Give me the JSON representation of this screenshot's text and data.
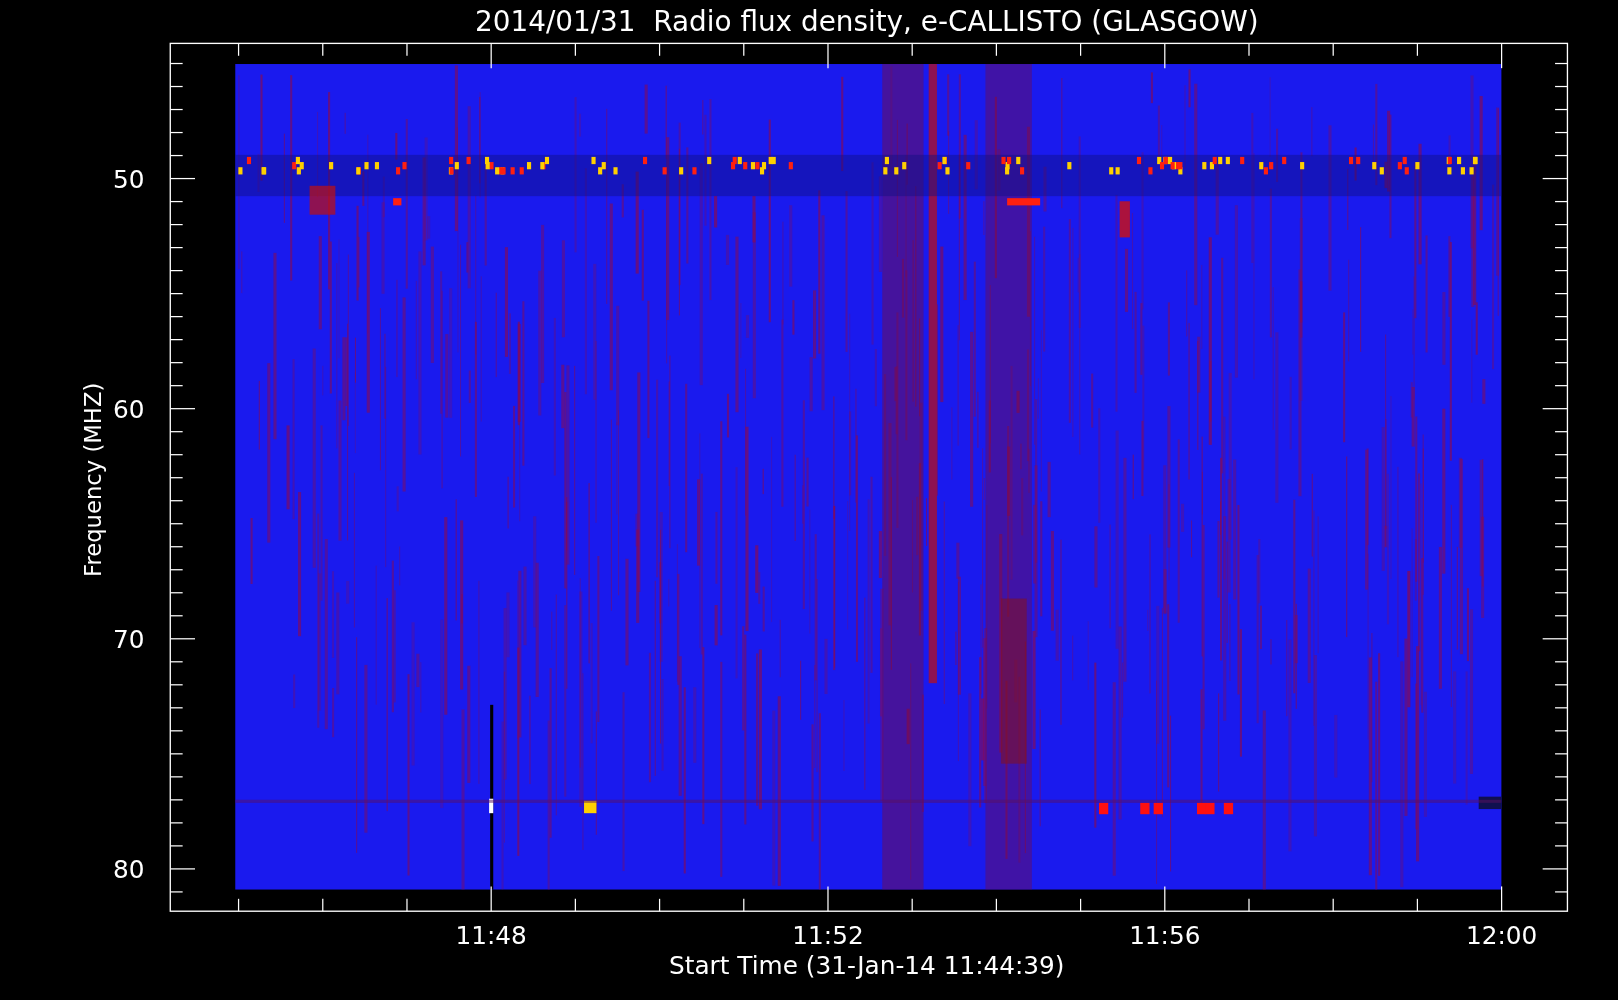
{
  "chart": {
    "title": "2014/01/31  Radio flux density, e-CALLISTO (GLASGOW)",
    "xlabel": "Start Time (31-Jan-14 11:44:39)",
    "ylabel": "Frequency (MHZ)",
    "xtick_labels": [
      "11:48",
      "11:52",
      "11:56",
      "12:00"
    ],
    "ytick_labels": [
      "50",
      "60",
      "70",
      "80"
    ]
  }
}
